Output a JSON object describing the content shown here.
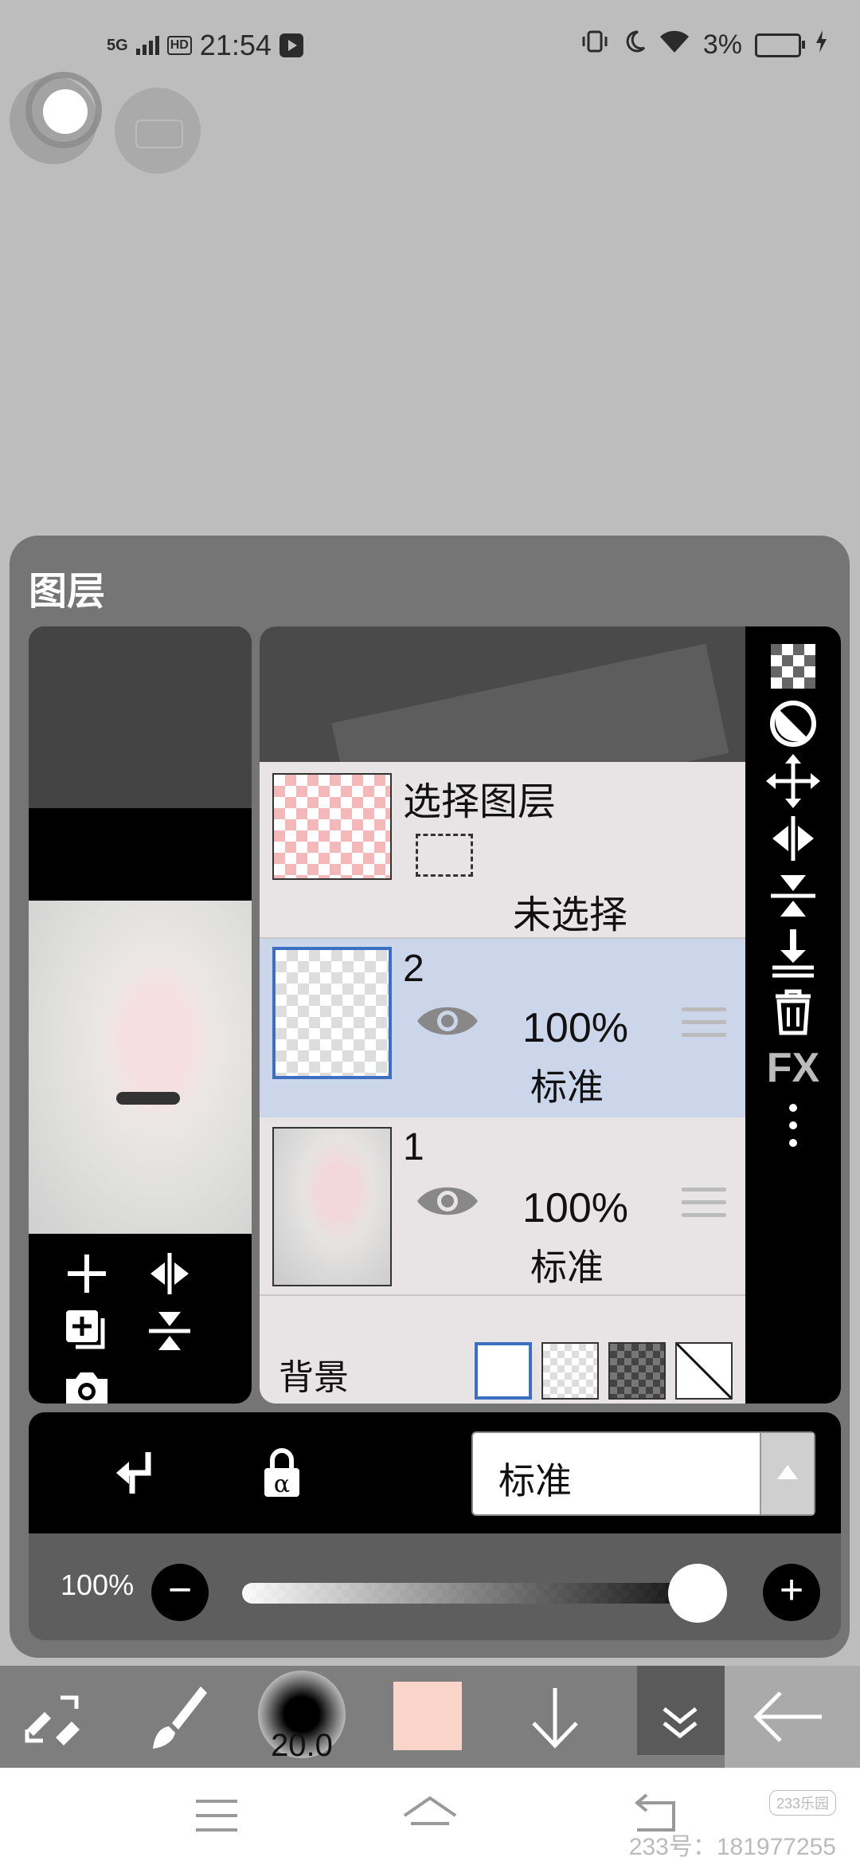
{
  "status_bar": {
    "network": "5G",
    "hd": "HD",
    "time": "21:54",
    "battery": "3%"
  },
  "layer_panel": {
    "title": "图层",
    "selection_layer": {
      "name": "选择图层",
      "state": "未选择"
    },
    "layers": [
      {
        "name": "2",
        "opacity": "100%",
        "mode": "标准",
        "selected": true
      },
      {
        "name": "1",
        "opacity": "100%",
        "mode": "标准",
        "selected": false
      }
    ],
    "background_label": "背景",
    "blend_mode": "标准",
    "opacity_value": "100%",
    "opacity_fraction": 1.0,
    "side_tools": [
      "checker-icon",
      "invert-icon",
      "move-icon",
      "flip-horizontal-icon",
      "flip-vertical-icon",
      "merge-down-icon",
      "trash-icon",
      "FX",
      "more-icon"
    ],
    "fx_label": "FX"
  },
  "toolbar": {
    "brush_size": "20.0",
    "color": "#f9d4c8"
  },
  "watermark": {
    "badge": "233乐园",
    "text": "233号：181977255"
  },
  "colors": {
    "selected_row": "#cbd6ea",
    "selected_border": "#3a6fc2"
  }
}
